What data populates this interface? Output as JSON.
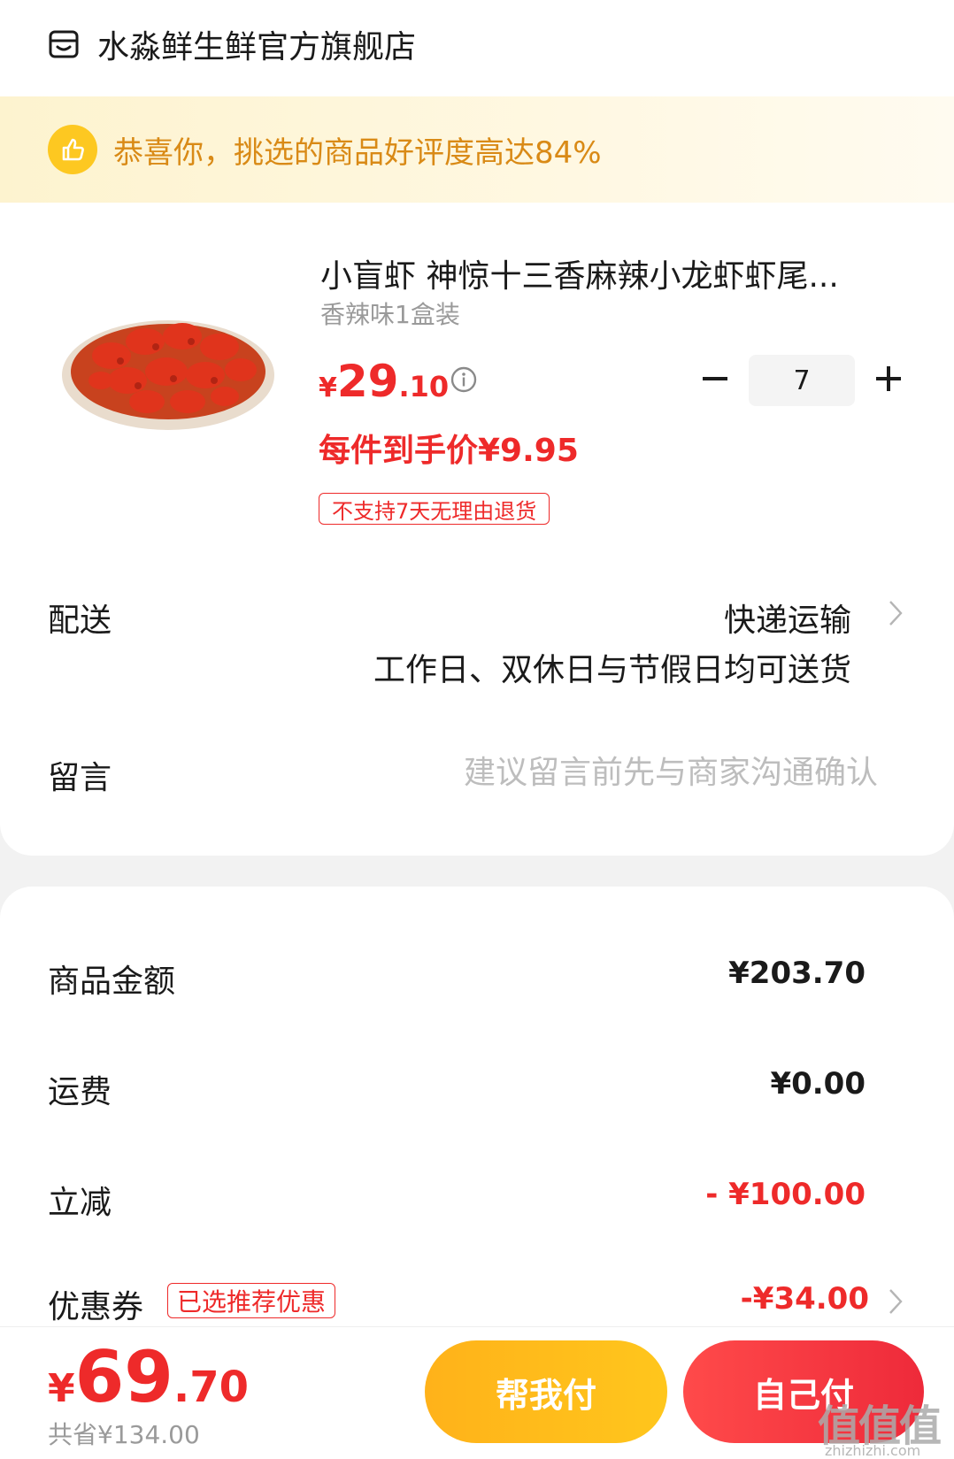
{
  "store": {
    "name": "水淼鲜生鲜官方旗舰店",
    "icon": "store-icon"
  },
  "banner": {
    "text": "恭喜你，挑选的商品好评度高达84%",
    "icon": "thumbs-up-icon"
  },
  "product": {
    "title": "小盲虾 神惊十三香麻辣小龙虾虾尾...",
    "spec": "香辣味1盒装",
    "price_currency": "¥",
    "price_int": "29",
    "price_dec": ".10",
    "quantity": "7",
    "unit_price": "每件到手价¥9.95",
    "return_tag": "不支持7天无理由退货"
  },
  "delivery": {
    "label": "配送",
    "method": "快递运输",
    "desc": "工作日、双休日与节假日均可送货"
  },
  "message": {
    "label": "留言",
    "placeholder": "建议留言前先与商家沟通确认"
  },
  "summary": {
    "goods_label": "商品金额",
    "goods_value": "¥203.70",
    "freight_label": "运费",
    "freight_value": "¥0.00",
    "discount_label": "立减",
    "discount_value": "- ¥100.00",
    "coupon_label": "优惠券",
    "coupon_tag": "已选推荐优惠",
    "coupon_value": "-¥34.00"
  },
  "footer": {
    "total_currency": "¥",
    "total_int": "69",
    "total_dec": ".70",
    "saved": "共省¥134.00",
    "help_pay": "帮我付",
    "self_pay": "自己付"
  },
  "watermark": {
    "text": "值值值",
    "sub": "zhizhizhi.com"
  },
  "colors": {
    "accent": "#ee2a2a",
    "banner_text": "#d98a16",
    "help_btn": "#ffb21a"
  }
}
